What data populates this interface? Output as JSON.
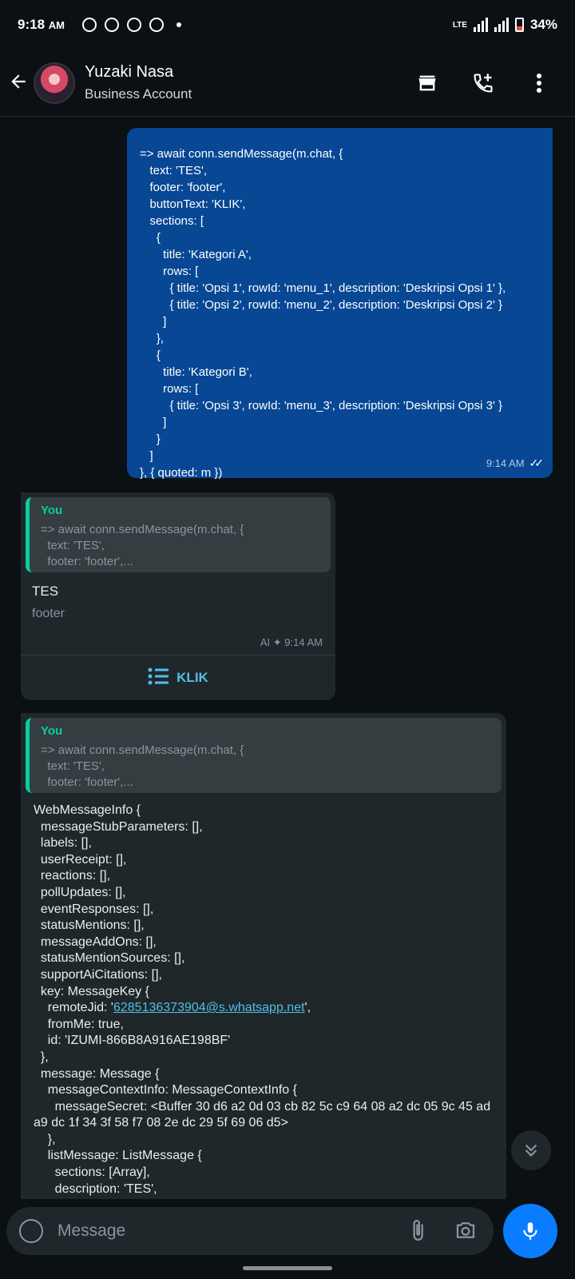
{
  "status": {
    "time": "9:18",
    "ampm": "AM",
    "network": "LTE",
    "battery": "34%"
  },
  "header": {
    "name": "Yuzaki Nasa",
    "subtitle": "Business Account"
  },
  "outgoing": {
    "code": "=> await conn.sendMessage(m.chat, {\n   text: 'TES',\n   footer: 'footer',\n   buttonText: 'KLIK',\n   sections: [\n     {\n       title: 'Kategori A',\n       rows: [\n         { title: 'Opsi 1', rowId: 'menu_1', description: 'Deskripsi Opsi 1' },\n         { title: 'Opsi 2', rowId: 'menu_2', description: 'Deskripsi Opsi 2' }\n       ]\n     },\n     {\n       title: 'Kategori B',\n       rows: [\n         { title: 'Opsi 3', rowId: 'menu_3', description: 'Deskripsi Opsi 3' }\n       ]\n     }\n   ]\n}, { quoted: m })",
    "time": "9:14 AM"
  },
  "list_message": {
    "quote_author": "You",
    "quote_text": "=> await conn.sendMessage(m.chat, {\n  text: 'TES',\n  footer: 'footer',...",
    "text": "TES",
    "footer": "footer",
    "meta": "AI ✦ 9:14 AM",
    "button_label": "KLIK"
  },
  "info_message": {
    "quote_author": "You",
    "quote_text": "=> await conn.sendMessage(m.chat, {\n  text: 'TES',\n  footer: 'footer',...",
    "body_before_link": "WebMessageInfo {\n  messageStubParameters: [],\n  labels: [],\n  userReceipt: [],\n  reactions: [],\n  pollUpdates: [],\n  eventResponses: [],\n  statusMentions: [],\n  messageAddOns: [],\n  statusMentionSources: [],\n  supportAiCitations: [],\n  key: MessageKey {\n    remoteJid: '",
    "link": "6285136373904@s.whatsapp.net",
    "body_after_link": "',\n    fromMe: true,\n    id: 'IZUMI-866B8A916AE198BF'\n  },\n  message: Message {\n    messageContextInfo: MessageContextInfo {\n      messageSecret: <Buffer 30 d6 a2 0d 03 cb 82 5c c9 64 08 a2 dc 05 9c 45 ad a9 dc 1f 34 3f 58 f7 08 2e dc 29 5f 69 06 d5>\n    },\n    listMessage: ListMessage {\n      sections: [Array],\n      description: 'TES',\n      buttonText: 'KLIK',"
  },
  "composer": {
    "placeholder": "Message"
  }
}
